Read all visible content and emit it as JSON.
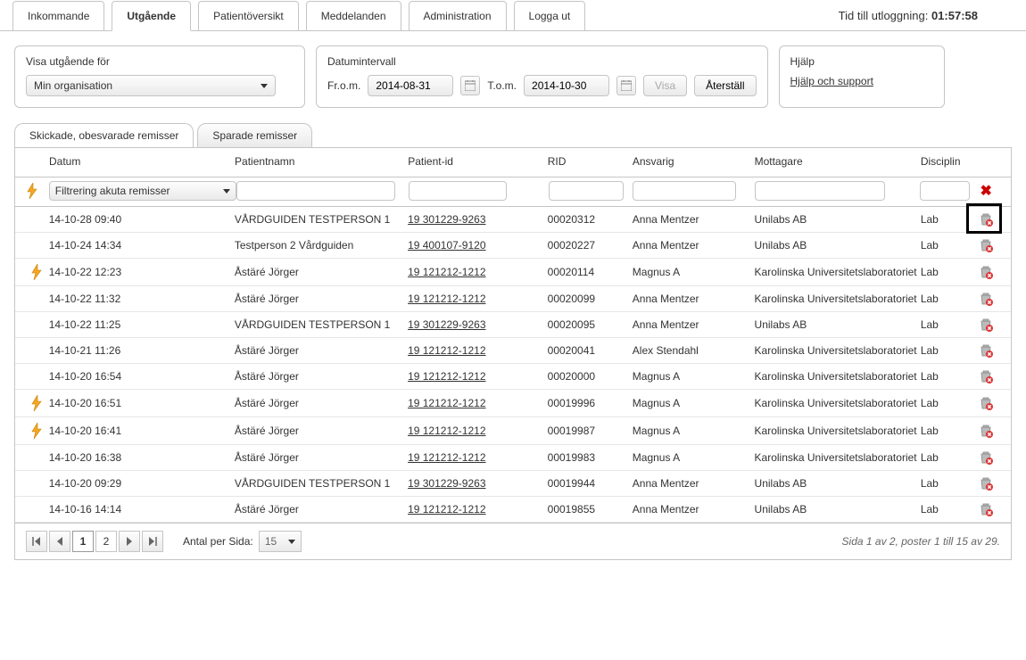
{
  "header": {
    "tabs": [
      "Inkommande",
      "Utgående",
      "Patientöversikt",
      "Meddelanden",
      "Administration",
      "Logga ut"
    ],
    "active_tab": 1,
    "logout_label_prefix": "Tid till utloggning:",
    "logout_time": "01:57:58"
  },
  "filters": {
    "org_title": "Visa utgående för",
    "org_value": "Min organisation",
    "date_title": "Datumintervall",
    "from_label": "Fr.o.m.",
    "from_value": "2014-08-31",
    "to_label": "T.o.m.",
    "to_value": "2014-10-30",
    "show_btn": "Visa",
    "reset_btn": "Återställ",
    "help_title": "Hjälp",
    "help_link": "Hjälp och support"
  },
  "subtabs": {
    "items": [
      "Skickade, obesvarade remisser",
      "Sparade remisser"
    ],
    "active": 0
  },
  "grid": {
    "headers": {
      "datum": "Datum",
      "patientnamn": "Patientnamn",
      "patientid": "Patient-id",
      "rid": "RID",
      "ansvarig": "Ansvarig",
      "mottagare": "Mottagare",
      "disciplin": "Disciplin"
    },
    "filter_select_value": "Filtrering akuta remisser",
    "rows": [
      {
        "bolt": false,
        "datum": "14-10-28 09:40",
        "patientnamn": "VÅRDGUIDEN TESTPERSON 1",
        "patientid": "19 301229-9263",
        "rid": "00020312",
        "ansvarig": "Anna Mentzer",
        "mottagare": "Unilabs AB",
        "disciplin": "Lab"
      },
      {
        "bolt": false,
        "datum": "14-10-24 14:34",
        "patientnamn": "Testperson 2 Vårdguiden",
        "patientid": "19 400107-9120",
        "rid": "00020227",
        "ansvarig": "Anna Mentzer",
        "mottagare": "Unilabs AB",
        "disciplin": "Lab"
      },
      {
        "bolt": true,
        "datum": "14-10-22 12:23",
        "patientnamn": "Åstäré Jörger",
        "patientid": "19 121212-1212",
        "rid": "00020114",
        "ansvarig": "Magnus A",
        "mottagare": "Karolinska Universitetslaboratoriet",
        "disciplin": "Lab"
      },
      {
        "bolt": false,
        "datum": "14-10-22 11:32",
        "patientnamn": "Åstäré Jörger",
        "patientid": "19 121212-1212",
        "rid": "00020099",
        "ansvarig": "Anna Mentzer",
        "mottagare": "Karolinska Universitetslaboratoriet",
        "disciplin": "Lab"
      },
      {
        "bolt": false,
        "datum": "14-10-22 11:25",
        "patientnamn": "VÅRDGUIDEN TESTPERSON 1",
        "patientid": "19 301229-9263",
        "rid": "00020095",
        "ansvarig": "Anna Mentzer",
        "mottagare": "Unilabs AB",
        "disciplin": "Lab"
      },
      {
        "bolt": false,
        "datum": "14-10-21 11:26",
        "patientnamn": "Åstäré Jörger",
        "patientid": "19 121212-1212",
        "rid": "00020041",
        "ansvarig": "Alex Stendahl",
        "mottagare": "Karolinska Universitetslaboratoriet",
        "disciplin": "Lab"
      },
      {
        "bolt": false,
        "datum": "14-10-20 16:54",
        "patientnamn": "Åstäré Jörger",
        "patientid": "19 121212-1212",
        "rid": "00020000",
        "ansvarig": "Magnus A",
        "mottagare": "Karolinska Universitetslaboratoriet",
        "disciplin": "Lab"
      },
      {
        "bolt": true,
        "datum": "14-10-20 16:51",
        "patientnamn": "Åstäré Jörger",
        "patientid": "19 121212-1212",
        "rid": "00019996",
        "ansvarig": "Magnus A",
        "mottagare": "Karolinska Universitetslaboratoriet",
        "disciplin": "Lab"
      },
      {
        "bolt": true,
        "datum": "14-10-20 16:41",
        "patientnamn": "Åstäré Jörger",
        "patientid": "19 121212-1212",
        "rid": "00019987",
        "ansvarig": "Magnus A",
        "mottagare": "Karolinska Universitetslaboratoriet",
        "disciplin": "Lab"
      },
      {
        "bolt": false,
        "datum": "14-10-20 16:38",
        "patientnamn": "Åstäré Jörger",
        "patientid": "19 121212-1212",
        "rid": "00019983",
        "ansvarig": "Magnus A",
        "mottagare": "Karolinska Universitetslaboratoriet",
        "disciplin": "Lab"
      },
      {
        "bolt": false,
        "datum": "14-10-20 09:29",
        "patientnamn": "VÅRDGUIDEN TESTPERSON 1",
        "patientid": "19 301229-9263",
        "rid": "00019944",
        "ansvarig": "Anna Mentzer",
        "mottagare": "Unilabs AB",
        "disciplin": "Lab"
      },
      {
        "bolt": false,
        "datum": "14-10-16 14:14",
        "patientnamn": "Åstäré Jörger",
        "patientid": "19 121212-1212",
        "rid": "00019855",
        "ansvarig": "Anna Mentzer",
        "mottagare": "Unilabs AB",
        "disciplin": "Lab"
      }
    ]
  },
  "pager": {
    "per_page_label": "Antal per Sida:",
    "per_page_value": "15",
    "page_numbers": [
      "1",
      "2"
    ],
    "active_page": 0,
    "status": "Sida 1 av 2, poster 1 till 15 av 29."
  }
}
